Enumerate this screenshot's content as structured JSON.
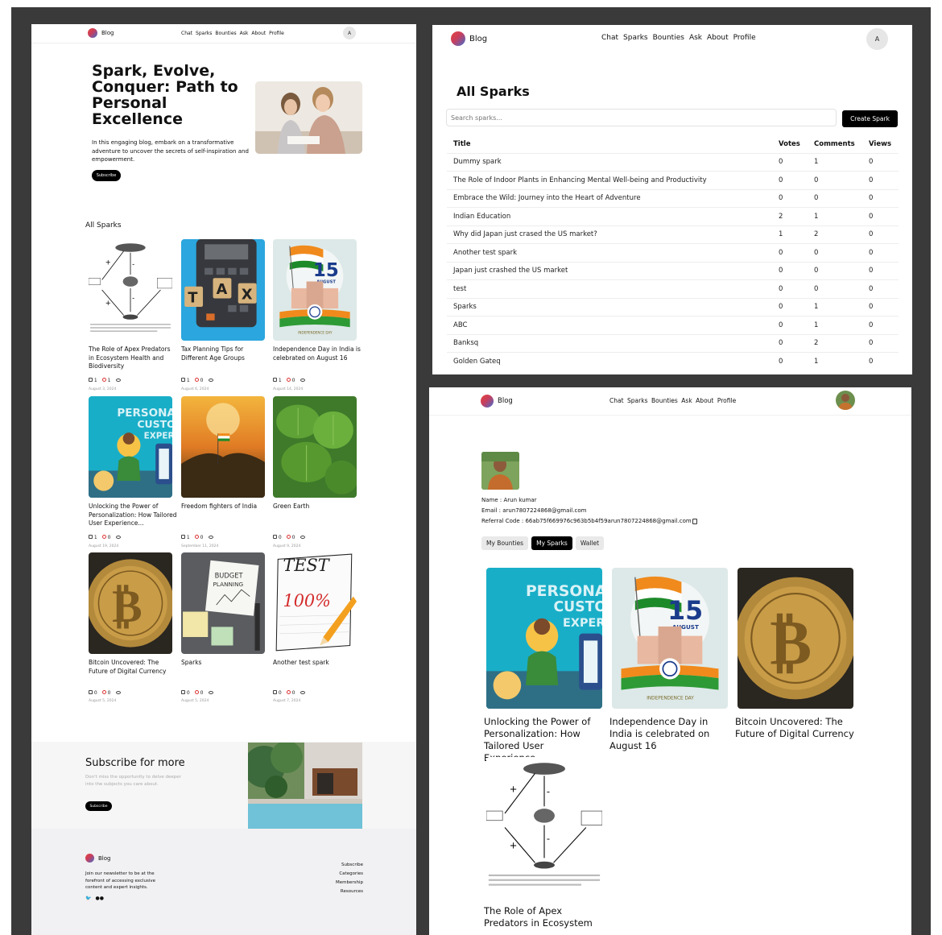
{
  "left": {
    "header": {
      "brand": "Blog",
      "nav": [
        "Chat",
        "Sparks",
        "Bounties",
        "Ask",
        "About",
        "Profile"
      ],
      "avatar": "A"
    },
    "hero": {
      "title": "Spark, Evolve, Conquer: Path to Personal Excellence",
      "description": "In this engaging blog, embark on a transformative adventure to uncover the secrets of self-inspiration and empowerment.",
      "subscribe": "Subscribe"
    },
    "section_title": "All Sparks",
    "cards": [
      {
        "title": "The Role of Apex Predators in Ecosystem Health and Biodiversity",
        "votes": "1",
        "comments": "1",
        "views": "0",
        "date": "August 3, 2024",
        "image": "ecosystem-diagram"
      },
      {
        "title": "Tax Planning Tips for Different Age Groups",
        "votes": "1",
        "comments": "0",
        "views": "0",
        "date": "August 6, 2024",
        "image": "tax-calculator"
      },
      {
        "title": "Independence Day in India is celebrated on August 16",
        "votes": "1",
        "comments": "0",
        "views": "0",
        "date": "August 14, 2024",
        "image": "independence-day"
      },
      {
        "title": "Unlocking the Power of Personalization: How Tailored User Experience...",
        "votes": "1",
        "comments": "0",
        "views": "0",
        "date": "August 19, 2024",
        "image": "personalization"
      },
      {
        "title": "Freedom fighters of India",
        "votes": "1",
        "comments": "0",
        "views": "0",
        "date": "September 11, 2024",
        "image": "freedom-flag"
      },
      {
        "title": "Green Earth",
        "votes": "0",
        "comments": "0",
        "views": "0",
        "date": "August 9, 2024",
        "image": "green-leaves"
      },
      {
        "title": "Bitcoin Uncovered: The Future of Digital Currency",
        "votes": "0",
        "comments": "0",
        "views": "0",
        "date": "August 5, 2024",
        "image": "bitcoin"
      },
      {
        "title": "Sparks",
        "votes": "0",
        "comments": "0",
        "views": "0",
        "date": "August 5, 2024",
        "image": "budget-planning"
      },
      {
        "title": "Another test spark",
        "votes": "0",
        "comments": "0",
        "views": "0",
        "date": "August 7, 2024",
        "image": "test-paper"
      }
    ],
    "subscribe_block": {
      "title": "Subscribe for more",
      "text": "Don't miss the opportunity to delve deeper into the subjects you care about.",
      "button": "Subscribe"
    },
    "footer": {
      "brand": "Blog",
      "text": "Join our newsletter to be at the forefront of accessing exclusive content and expert insights.",
      "links": [
        "Subscribe",
        "Categories",
        "Membership",
        "Resources"
      ]
    }
  },
  "top_right": {
    "header": {
      "brand": "Blog",
      "nav": [
        "Chat",
        "Sparks",
        "Bounties",
        "Ask",
        "About",
        "Profile"
      ],
      "avatar": "A"
    },
    "title": "All Sparks",
    "search": {
      "placeholder": "Search sparks..."
    },
    "create_button": "Create Spark",
    "columns": [
      "Title",
      "Votes",
      "Comments",
      "Views"
    ],
    "rows": [
      [
        "Dummy spark",
        "0",
        "1",
        "0"
      ],
      [
        "The Role of Indoor Plants in Enhancing Mental Well-being and Productivity",
        "0",
        "0",
        "0"
      ],
      [
        "Embrace the Wild: Journey into the Heart of Adventure",
        "0",
        "0",
        "0"
      ],
      [
        "Indian Education",
        "2",
        "1",
        "0"
      ],
      [
        "Why did Japan just crased the US market?",
        "1",
        "2",
        "0"
      ],
      [
        "Another test spark",
        "0",
        "0",
        "0"
      ],
      [
        "Japan just crashed the US market",
        "0",
        "0",
        "0"
      ],
      [
        "test",
        "0",
        "0",
        "0"
      ],
      [
        "Sparks",
        "0",
        "1",
        "0"
      ],
      [
        "ABC",
        "0",
        "1",
        "0"
      ],
      [
        "Banksq",
        "0",
        "2",
        "0"
      ],
      [
        "Golden Gateq",
        "0",
        "1",
        "0"
      ]
    ]
  },
  "bottom_right": {
    "header": {
      "brand": "Blog",
      "nav": [
        "Chat",
        "Sparks",
        "Bounties",
        "Ask",
        "About",
        "Profile"
      ]
    },
    "profile": {
      "name": "Name : Arun kumar",
      "email": "Email : arun7807224868@gmail.com",
      "referral": "Referral Code : 66ab75f669976c963b5b4f59arun7807224868@gmail.com"
    },
    "tabs": [
      "My Bounties",
      "My Sparks",
      "Wallet"
    ],
    "active_tab": "My Sparks",
    "cards": [
      {
        "title": "Unlocking the Power of Personalization: How Tailored User Experience...",
        "image": "personalization"
      },
      {
        "title": "Independence Day in India is celebrated on August 16",
        "image": "independence-day"
      },
      {
        "title": "Bitcoin Uncovered: The Future of Digital Currency",
        "image": "bitcoin"
      },
      {
        "title": "The Role of Apex Predators in Ecosystem",
        "image": "ecosystem-diagram"
      }
    ]
  },
  "image_text": {
    "tax_letters": [
      "T",
      "A",
      "X"
    ],
    "date_number": "15",
    "date_month": "AUGUST",
    "personal_lines": [
      "PERSONALI",
      "CUSTO",
      "EXPERI"
    ],
    "budget_lines": [
      "BUDGET",
      "PLANNING"
    ],
    "test_word": "TEST",
    "test_score": "100%",
    "btc_symbol": "₿",
    "diagram_caption": "Fragment ag (time since isolation)",
    "diagram_left": "Fragment size",
    "diagram_figure_caption": "gure 1 Model of the combined effects of trophic cascades and site (geographical processes on top predators (for example, coyotes), mes cleidine (domestic cat) and prey (bird-breeding birds) in a fragment. stem Direction of the interaction is indicated with a plus or minus.",
    "independence_sub": "INDEPENDENCE DAY"
  },
  "colors": {
    "dark_bg": "#3a3a3a",
    "accent": "#000000",
    "comment_red": "#dd3333"
  }
}
